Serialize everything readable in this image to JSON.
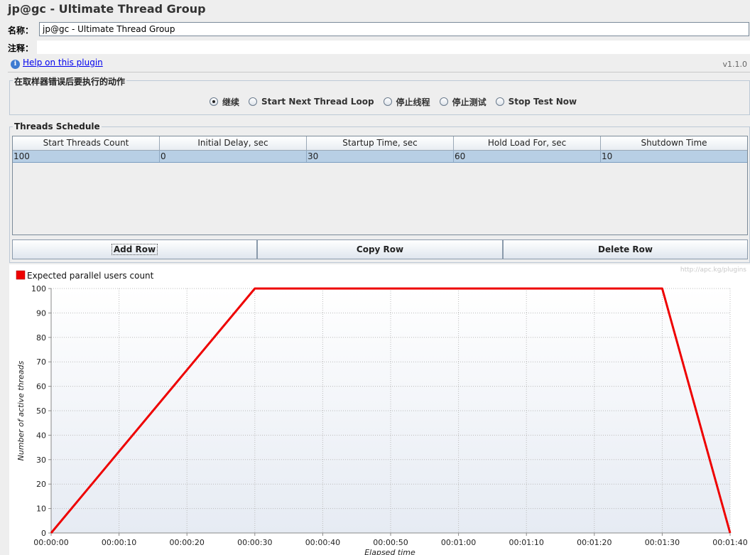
{
  "header": {
    "title": "jp@gc - Ultimate Thread Group"
  },
  "form": {
    "name_label": "名称：",
    "name_value": "jp@gc - Ultimate Thread Group",
    "comment_label": "注释：",
    "comment_value": ""
  },
  "help": {
    "link_text": "Help on this plugin",
    "version": "v1.1.0",
    "icon": "info-icon"
  },
  "error_action": {
    "title": "在取样器错误后要执行的动作",
    "options": [
      "继续",
      "Start Next Thread Loop",
      "停止线程",
      "停止测试",
      "Stop Test Now"
    ],
    "selected": "继续"
  },
  "schedule": {
    "title": "Threads Schedule",
    "columns": [
      "Start Threads Count",
      "Initial Delay, sec",
      "Startup Time, sec",
      "Hold Load For, sec",
      "Shutdown Time"
    ],
    "rows": [
      [
        "100",
        "0",
        "30",
        "60",
        "10"
      ]
    ],
    "buttons": {
      "add": "Add Row",
      "copy": "Copy Row",
      "delete": "Delete Row"
    }
  },
  "chart_data": {
    "type": "line",
    "legend": "Expected parallel users count",
    "watermark": "http://apc.kg/plugins",
    "xlabel": "Elapsed time",
    "ylabel": "Number of active threads",
    "x_ticks": [
      "00:00:00",
      "00:00:10",
      "00:00:20",
      "00:00:30",
      "00:00:40",
      "00:00:50",
      "00:01:00",
      "00:01:10",
      "00:01:20",
      "00:01:30",
      "00:01:40"
    ],
    "y_ticks": [
      "0",
      "10",
      "20",
      "30",
      "40",
      "50",
      "60",
      "70",
      "80",
      "90",
      "100"
    ],
    "xlim": [
      0,
      100
    ],
    "ylim": [
      0,
      100
    ],
    "grid": true,
    "series": [
      {
        "name": "Expected parallel users count",
        "color": "#ee0000",
        "x": [
          0,
          30,
          90,
          100
        ],
        "y": [
          0,
          100,
          100,
          0
        ]
      }
    ]
  }
}
